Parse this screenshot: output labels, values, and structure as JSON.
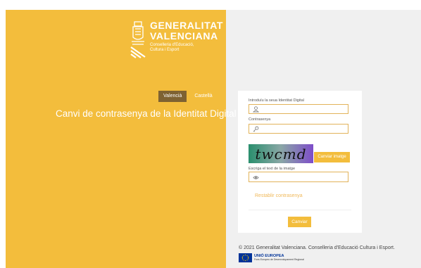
{
  "brand": {
    "line1": "GENERALITAT",
    "line2": "VALENCIANA",
    "subtitle_line1": "Conselleria d'Educació,",
    "subtitle_line2": "Cultura i Esport"
  },
  "languages": [
    {
      "label": "Valencià",
      "active": true
    },
    {
      "label": "Castellà",
      "active": false
    }
  ],
  "page_title": "Canvi de contrasenya de la Identitat Digital",
  "form": {
    "username_label": "Introduïu la seua Identitat Digital",
    "password_label": "Contrasenya",
    "captcha_text": "twcmd",
    "change_image_button": "Canviar imatge",
    "captcha_input_label": "Escriga el text de la imatge",
    "reset_link": "Restablir contrasenya",
    "submit_button": "Canviar"
  },
  "footer": {
    "copyright": "© 2021 Generalitat Valenciana. Conselleria d'Educació Cultura i Esport.",
    "eu_title": "UNIÓ EUROPEA",
    "eu_subtitle": "Fons Europeu de Desenvolupament Regional"
  },
  "colors": {
    "brand_yellow": "#f3bd3c",
    "active_lang": "#7e6232",
    "input_border": "#e2b35a",
    "eu_blue": "#003399"
  }
}
